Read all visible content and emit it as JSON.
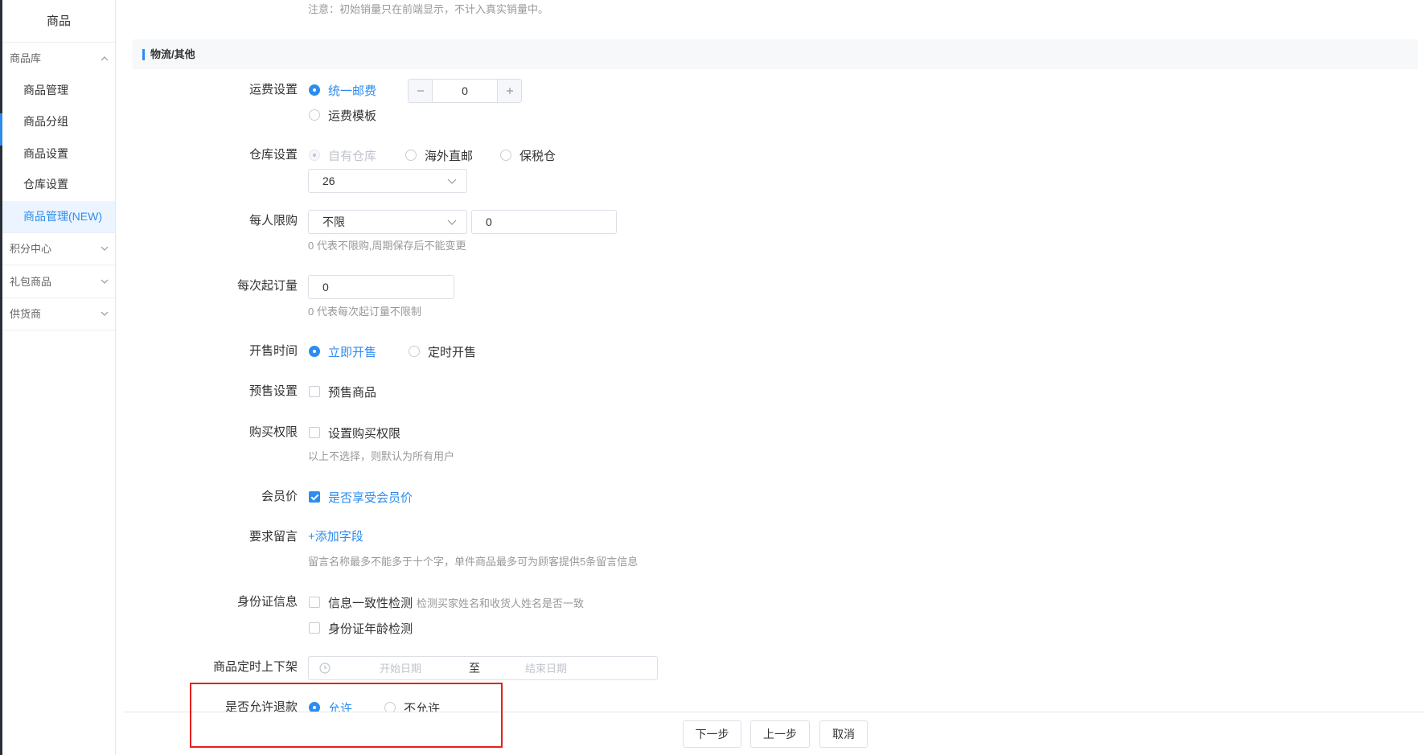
{
  "colors": {
    "accent": "#2d8cf0",
    "accent_bg": "#ecf5ff",
    "text": "#333333",
    "muted": "#999999",
    "disabled": "#c0c4cc",
    "border": "#dcdfe6",
    "section_bg": "#f7f8fa",
    "annotation": "#e5201d",
    "frame": "#2a2e37"
  },
  "sidebar": {
    "title": "商品",
    "groups": [
      {
        "label": "商品库",
        "icon": "chevron-up-icon",
        "items": [
          {
            "label": "商品管理",
            "active": false
          },
          {
            "label": "商品分组",
            "active": false
          },
          {
            "label": "商品设置",
            "active": false
          },
          {
            "label": "仓库设置",
            "active": false
          },
          {
            "label": "商品管理(NEW)",
            "active": true
          }
        ]
      },
      {
        "label": "积分中心",
        "icon": "chevron-down-icon"
      },
      {
        "label": "礼包商品",
        "icon": "chevron-down-icon"
      },
      {
        "label": "供货商",
        "icon": "chevron-down-icon"
      }
    ]
  },
  "sales_note": "注意：初始销量只在前端显示，不计入真实销量中。",
  "section": {
    "title": "物流/其他"
  },
  "form": {
    "shipping": {
      "label": "运费设置",
      "options": [
        {
          "label": "统一邮费",
          "checked": true
        },
        {
          "label": "运费模板",
          "checked": false
        }
      ],
      "stepper": {
        "value": "0",
        "icons": [
          "minus-icon",
          "plus-icon"
        ]
      }
    },
    "warehouse": {
      "label": "仓库设置",
      "options": [
        {
          "label": "自有仓库",
          "checked": true,
          "disabled": true
        },
        {
          "label": "海外直邮",
          "checked": false
        },
        {
          "label": "保税仓",
          "checked": false
        }
      ],
      "select": {
        "value": "26",
        "icon": "chevron-down-icon"
      }
    },
    "purchase_limit": {
      "label": "每人限购",
      "select": {
        "value": "不限",
        "icon": "chevron-down-icon"
      },
      "input_value": "0",
      "hint": "0 代表不限购,周期保存后不能变更"
    },
    "min_order": {
      "label": "每次起订量",
      "input_value": "0",
      "hint": "0 代表每次起订量不限制"
    },
    "sale_time": {
      "label": "开售时间",
      "options": [
        {
          "label": "立即开售",
          "checked": true
        },
        {
          "label": "定时开售",
          "checked": false
        }
      ]
    },
    "presale": {
      "label": "预售设置",
      "checkbox": {
        "label": "预售商品",
        "checked": false
      }
    },
    "purchase_permission": {
      "label": "购买权限",
      "checkbox": {
        "label": "设置购买权限",
        "checked": false
      },
      "hint": "以上不选择，则默认为所有用户"
    },
    "member_price": {
      "label": "会员价",
      "checkbox": {
        "label": "是否享受会员价",
        "checked": true
      }
    },
    "message": {
      "label": "要求留言",
      "link": "+添加字段",
      "hint": "留言名称最多不能多于十个字，单件商品最多可为顾客提供5条留言信息"
    },
    "id_info": {
      "label": "身份证信息",
      "checks": [
        {
          "label": "信息一致性检测",
          "checked": false,
          "note": "检测买家姓名和收货人姓名是否一致"
        },
        {
          "label": "身份证年龄检测",
          "checked": false
        }
      ]
    },
    "schedule": {
      "label": "商品定时上下架",
      "icon": "clock-icon",
      "start_placeholder": "开始日期",
      "separator": "至",
      "end_placeholder": "结束日期"
    },
    "refund": {
      "label": "是否允许退款",
      "options": [
        {
          "label": "允许",
          "checked": true
        },
        {
          "label": "不允许",
          "checked": false
        }
      ]
    }
  },
  "footer": {
    "next": "下一步",
    "prev": "上一步",
    "cancel": "取消"
  }
}
